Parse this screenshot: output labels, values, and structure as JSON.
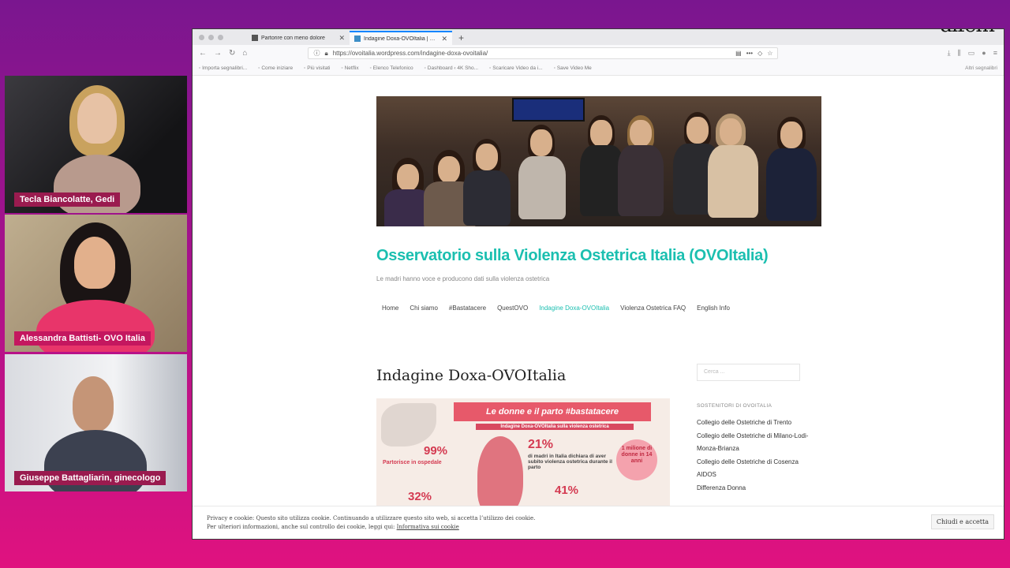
{
  "participants": [
    {
      "name": "Tecla Biancolatte, Gedi"
    },
    {
      "name": "Alessandra Battisti- OVO Italia"
    },
    {
      "name": "Giuseppe Battagliarin, ginecologo"
    }
  ],
  "brand": {
    "logo_text": "alfem"
  },
  "browser": {
    "tabs": [
      {
        "title": "Partorire con meno dolore",
        "active": false
      },
      {
        "title": "Indagine Doxa-OVOItalia | Oss",
        "active": true
      }
    ],
    "url": "https://ovoitalia.wordpress.com/indagine-doxa-ovoitalia/",
    "bookmarks": [
      "Importa segnalibri...",
      "Come iniziare",
      "Più visitati",
      "Netflix",
      "Elenco Telefonico",
      "Dashboard ‹ 4K Sho...",
      "Scaricare Video da i...",
      "Save Video Me"
    ],
    "bookmarks_right": "Altri segnalibri"
  },
  "site": {
    "title": "Osservatorio sulla Violenza Ostetrica Italia (OVOItalia)",
    "tagline": "Le madri hanno voce e producono dati sulla violenza ostetrica",
    "menu": [
      "Home",
      "Chi siamo",
      "#Bastatacere",
      "QuestOVO",
      "Indagine Doxa-OVOItalia",
      "Violenza Ostetrica FAQ",
      "English Info"
    ],
    "post_title": "Indagine Doxa-OVOItalia",
    "infographic": {
      "banner": "Le donne e il parto #bastatacere",
      "subtitle": "Indagine Doxa-OVOItalia sulla violenza ostetrica",
      "stat_1": "99%",
      "stat_1_label": "Partorisce in ospedale",
      "stat_2": "21%",
      "stat_2_label": "di madri in Italia dichiara di aver subito violenza ostetrica durante il parto",
      "stat_3": "1 milione di donne in 14 anni",
      "stat_4": "32%",
      "stat_5": "41%"
    },
    "sidebar": {
      "search_placeholder": "Cerca ...",
      "widget_title": "Sostenitori di OVOItalia",
      "supporters": [
        "Collegio delle Ostetriche di Trento",
        "Collegio delle Ostetriche di Milano-Lodi-Monza-Brianza",
        "Collegio delle Ostetriche di Cosenza",
        "AIDOS",
        "Differenza Donna"
      ]
    },
    "cookie": {
      "line1": "Privacy e cookie: Questo sito utilizza cookie. Continuando a utilizzare questo sito web, si accetta l’utilizzo dei cookie.",
      "line2": "Per ulteriori informazioni, anche sul controllo dei cookie, leggi qui:",
      "link": "Informativa sui cookie",
      "button": "Chiudi e accetta"
    }
  }
}
